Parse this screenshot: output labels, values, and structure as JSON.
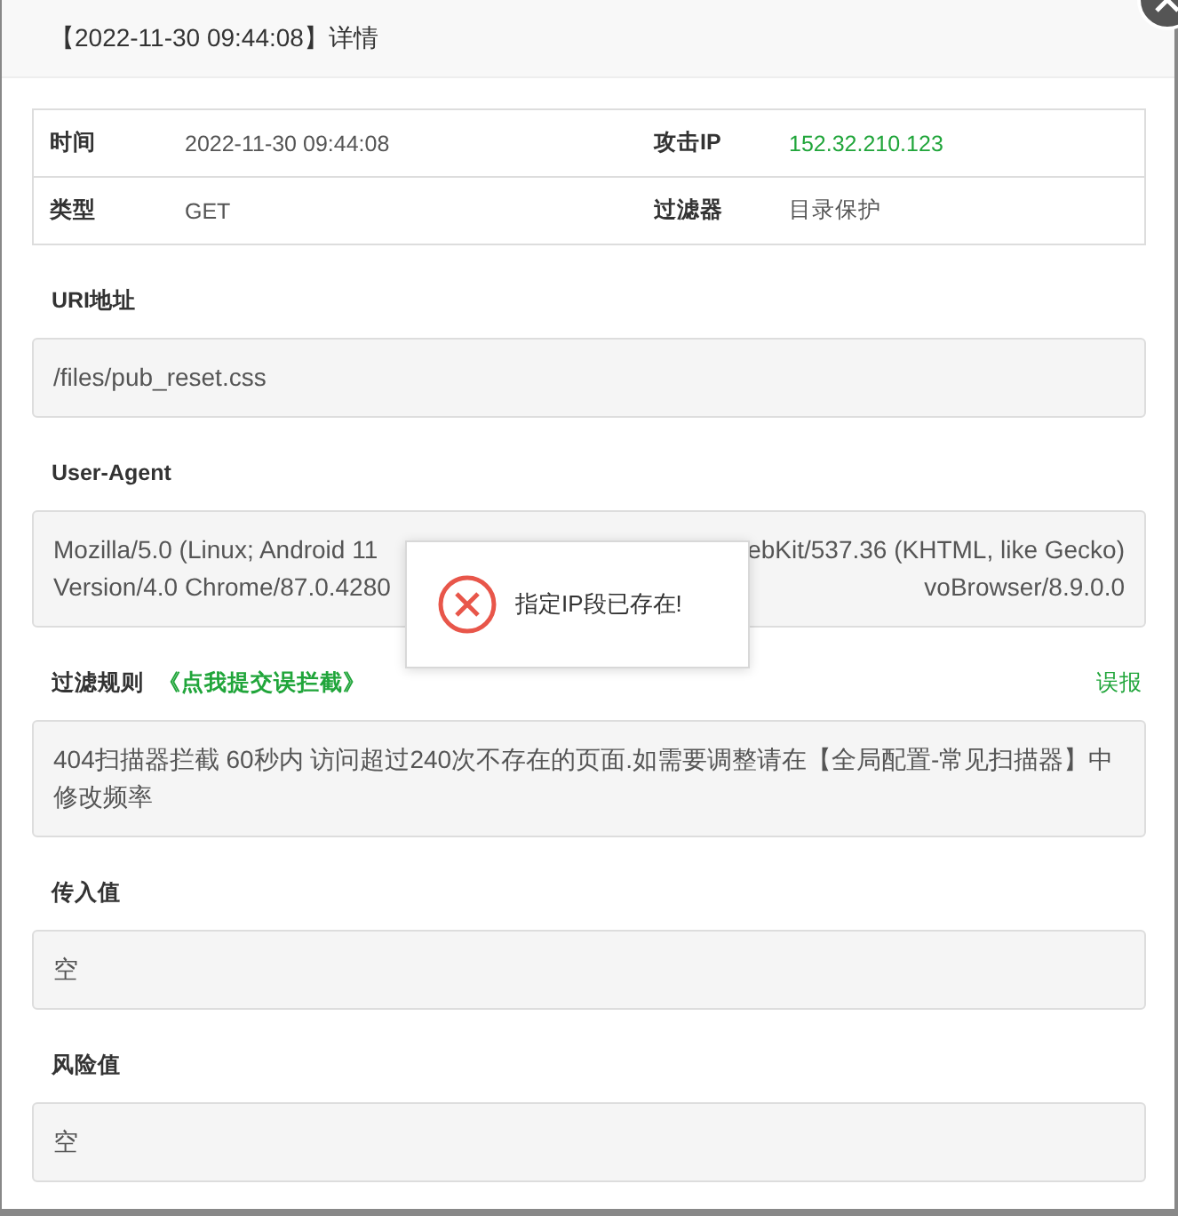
{
  "dialog": {
    "title": "【2022-11-30 09:44:08】详情"
  },
  "info_table": {
    "rows": [
      {
        "cells": [
          {
            "label": "时间",
            "value": "2022-11-30 09:44:08",
            "highlight": false
          },
          {
            "label": "攻击IP",
            "value": "152.32.210.123",
            "highlight": true
          }
        ]
      },
      {
        "cells": [
          {
            "label": "类型",
            "value": "GET",
            "highlight": false
          },
          {
            "label": "过滤器",
            "value": "目录保护",
            "highlight": false
          }
        ]
      }
    ]
  },
  "sections": [
    {
      "kind": "plain",
      "label": "URI地址",
      "value": "/files/pub_reset.css"
    },
    {
      "kind": "split",
      "label": "User-Agent",
      "lines": [
        {
          "left": "Mozilla/5.0 (Linux; Android 11",
          "right": "ebKit/537.36 (KHTML, like Gecko)"
        },
        {
          "left": "Version/4.0 Chrome/87.0.4280",
          "right": "voBrowser/8.9.0.0"
        }
      ]
    },
    {
      "kind": "rule",
      "label": "过滤规则",
      "link": "《点我提交误拦截》",
      "report": "误报",
      "value": "404扫描器拦截 60秒内 访问超过240次不存在的页面.如需要调整请在【全局配置-常见扫描器】中修改频率"
    },
    {
      "kind": "plain",
      "label": "传入值",
      "value": "空"
    },
    {
      "kind": "plain",
      "label": "风险值",
      "value": "空"
    }
  ],
  "toast": {
    "kind": "error",
    "message": "指定IP段已存在!"
  }
}
